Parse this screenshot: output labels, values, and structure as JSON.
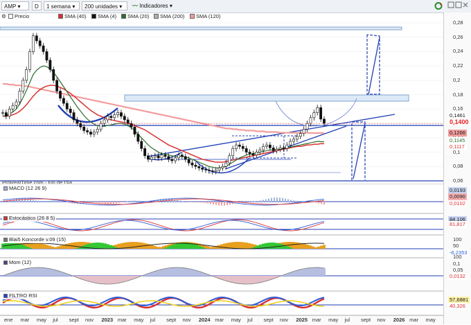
{
  "toolbar": {
    "symbol": "AMP",
    "period_d": "D",
    "interval": "1 semana",
    "units": "200 unidades",
    "indicators": "Indicadores"
  },
  "legend": [
    {
      "label": "Precio",
      "color": "#ffffff"
    },
    {
      "label": "SMA (40)",
      "color": "#d93030"
    },
    {
      "label": "SMA (4)",
      "color": "#111111"
    },
    {
      "label": "SMA (20)",
      "color": "#2d6b2d"
    },
    {
      "label": "SMA (200)",
      "color": "#b0b0b0"
    },
    {
      "label": "SMA (120)",
      "color": "#f29c9c"
    }
  ],
  "footnote": "ProRealTime.com - Fin de Día",
  "panels": {
    "macd": "MACD (12 26 9)",
    "stoch": "Estocástico (26 8 5)",
    "koncorde": "Blai5 Koncorde v.09 (15)",
    "mom": "Mom (12)",
    "rsi": "FILTRO RSI"
  },
  "price_axis_ticks": [
    "0,28",
    "0,26",
    "0,24",
    "0,22",
    "0,2",
    "0,18",
    "0,16",
    "0,14",
    "0,12",
    "0,1",
    "0,08",
    "0,06"
  ],
  "badges": {
    "price_top": "0,1461",
    "price_main": "0,1400",
    "sma120": "0,1266",
    "sma20": "0,1145",
    "sma40": "0,1117",
    "macd_a": "0,0193",
    "macd_b": "0,0090",
    "macd_c": "0,0102",
    "stoch_a": "84,106",
    "stoch_b": "81,817",
    "kon_100": "100",
    "kon_50": "50",
    "kon_a": "-6,2353",
    "kon_b": "100",
    "mom_a": "0,1",
    "mom_b": "0,05",
    "mom_c": "0,0132",
    "rsi_a": "57,6881",
    "rsi_b": "40,326"
  },
  "x_axis_labels": [
    {
      "label": "ene",
      "bold": false
    },
    {
      "label": "mar",
      "bold": false
    },
    {
      "label": "may",
      "bold": false
    },
    {
      "label": "jul",
      "bold": false
    },
    {
      "label": "sept",
      "bold": false
    },
    {
      "label": "nov",
      "bold": false
    },
    {
      "label": "2023",
      "bold": true
    },
    {
      "label": "mar",
      "bold": false
    },
    {
      "label": "may",
      "bold": false
    },
    {
      "label": "jul",
      "bold": false
    },
    {
      "label": "sept",
      "bold": false
    },
    {
      "label": "nov",
      "bold": false
    },
    {
      "label": "2024",
      "bold": true
    },
    {
      "label": "mar",
      "bold": false
    },
    {
      "label": "may",
      "bold": false
    },
    {
      "label": "jul",
      "bold": false
    },
    {
      "label": "sept",
      "bold": false
    },
    {
      "label": "nov",
      "bold": false
    },
    {
      "label": "2025",
      "bold": true
    },
    {
      "label": "mar",
      "bold": false
    },
    {
      "label": "may",
      "bold": false
    },
    {
      "label": "jul",
      "bold": false
    },
    {
      "label": "sept",
      "bold": false
    },
    {
      "label": "nov",
      "bold": false
    },
    {
      "label": "2026",
      "bold": true
    },
    {
      "label": "mar",
      "bold": false
    },
    {
      "label": "may",
      "bold": false
    }
  ],
  "chart_data": {
    "type": "line",
    "ylim": [
      0.06,
      0.28
    ],
    "price_weekly_close": [
      0.155,
      0.15,
      0.16,
      0.165,
      0.17,
      0.185,
      0.2,
      0.215,
      0.24,
      0.262,
      0.255,
      0.248,
      0.24,
      0.228,
      0.215,
      0.2,
      0.185,
      0.175,
      0.168,
      0.16,
      0.155,
      0.145,
      0.14,
      0.135,
      0.13,
      0.128,
      0.125,
      0.128,
      0.132,
      0.14,
      0.145,
      0.15,
      0.148,
      0.152,
      0.155,
      0.15,
      0.145,
      0.14,
      0.135,
      0.125,
      0.115,
      0.105,
      0.095,
      0.09,
      0.093,
      0.095,
      0.092,
      0.096,
      0.094,
      0.09,
      0.088,
      0.092,
      0.096,
      0.094,
      0.09,
      0.085,
      0.082,
      0.08,
      0.078,
      0.076,
      0.075,
      0.074,
      0.073,
      0.075,
      0.078,
      0.08,
      0.085,
      0.095,
      0.105,
      0.11,
      0.108,
      0.105,
      0.1,
      0.098,
      0.096,
      0.1,
      0.103,
      0.108,
      0.11,
      0.106,
      0.102,
      0.104,
      0.106,
      0.105,
      0.11,
      0.115,
      0.118,
      0.122,
      0.126,
      0.132,
      0.14,
      0.148,
      0.155,
      0.162,
      0.146,
      0.14
    ],
    "sma20": [
      0.15,
      0.151,
      0.153,
      0.156,
      0.16,
      0.167,
      0.176,
      0.186,
      0.197,
      0.208,
      0.214,
      0.218,
      0.22,
      0.219,
      0.216,
      0.211,
      0.205,
      0.198,
      0.191,
      0.184,
      0.177,
      0.17,
      0.163,
      0.157,
      0.151,
      0.146,
      0.142,
      0.139,
      0.137,
      0.136,
      0.136,
      0.137,
      0.138,
      0.139,
      0.14,
      0.14,
      0.139,
      0.137,
      0.134,
      0.13,
      0.125,
      0.12,
      0.115,
      0.11,
      0.106,
      0.103,
      0.1,
      0.098,
      0.097,
      0.096,
      0.095,
      0.094,
      0.094,
      0.094,
      0.093,
      0.092,
      0.09,
      0.088,
      0.086,
      0.084,
      0.082,
      0.08,
      0.079,
      0.078,
      0.078,
      0.079,
      0.08,
      0.083,
      0.086,
      0.089,
      0.092,
      0.094,
      0.096,
      0.097,
      0.098,
      0.099,
      0.1,
      0.101,
      0.102,
      0.103,
      0.103,
      0.104,
      0.104,
      0.105,
      0.106,
      0.107,
      0.108,
      0.109,
      0.11,
      0.111,
      0.112,
      0.113,
      0.114,
      0.115,
      0.1145,
      0.1145
    ],
    "sma40": [
      0.15,
      0.15,
      0.151,
      0.152,
      0.154,
      0.157,
      0.161,
      0.166,
      0.172,
      0.178,
      0.183,
      0.187,
      0.19,
      0.192,
      0.193,
      0.193,
      0.192,
      0.19,
      0.188,
      0.185,
      0.182,
      0.178,
      0.174,
      0.17,
      0.166,
      0.162,
      0.158,
      0.155,
      0.152,
      0.15,
      0.148,
      0.146,
      0.145,
      0.144,
      0.143,
      0.142,
      0.141,
      0.14,
      0.139,
      0.137,
      0.135,
      0.133,
      0.131,
      0.128,
      0.125,
      0.122,
      0.119,
      0.116,
      0.113,
      0.11,
      0.108,
      0.106,
      0.104,
      0.102,
      0.1,
      0.098,
      0.096,
      0.094,
      0.092,
      0.09,
      0.089,
      0.088,
      0.087,
      0.086,
      0.086,
      0.086,
      0.087,
      0.088,
      0.089,
      0.09,
      0.091,
      0.092,
      0.093,
      0.094,
      0.095,
      0.096,
      0.097,
      0.098,
      0.099,
      0.1,
      0.101,
      0.102,
      0.103,
      0.104,
      0.105,
      0.106,
      0.107,
      0.108,
      0.108,
      0.109,
      0.11,
      0.11,
      0.111,
      0.111,
      0.1117,
      0.1117
    ],
    "sma120": [
      0.195,
      0.195,
      0.194,
      0.194,
      0.193,
      0.193,
      0.192,
      0.192,
      0.191,
      0.19,
      0.189,
      0.188,
      0.187,
      0.186,
      0.185,
      0.184,
      0.183,
      0.182,
      0.181,
      0.18,
      0.179,
      0.178,
      0.177,
      0.176,
      0.175,
      0.174,
      0.173,
      0.172,
      0.171,
      0.17,
      0.169,
      0.168,
      0.167,
      0.166,
      0.165,
      0.164,
      0.163,
      0.162,
      0.161,
      0.16,
      0.159,
      0.158,
      0.157,
      0.156,
      0.155,
      0.154,
      0.153,
      0.152,
      0.151,
      0.15,
      0.149,
      0.148,
      0.147,
      0.146,
      0.145,
      0.144,
      0.143,
      0.142,
      0.141,
      0.14,
      0.139,
      0.138,
      0.137,
      0.136,
      0.135,
      0.134,
      0.133,
      0.133,
      0.132,
      0.132,
      0.131,
      0.131,
      0.13,
      0.13,
      0.13,
      0.129,
      0.129,
      0.129,
      0.128,
      0.128,
      0.128,
      0.128,
      0.127,
      0.127,
      0.127,
      0.127,
      0.127,
      0.127,
      0.127,
      0.127,
      0.127,
      0.1266,
      0.1266,
      0.1266,
      0.1266,
      0.1266
    ],
    "series": [
      {
        "name": "Precio"
      },
      {
        "name": "SMA (40)"
      },
      {
        "name": "SMA (4)"
      },
      {
        "name": "SMA (20)"
      },
      {
        "name": "SMA (200)"
      },
      {
        "name": "SMA (120)"
      }
    ]
  }
}
